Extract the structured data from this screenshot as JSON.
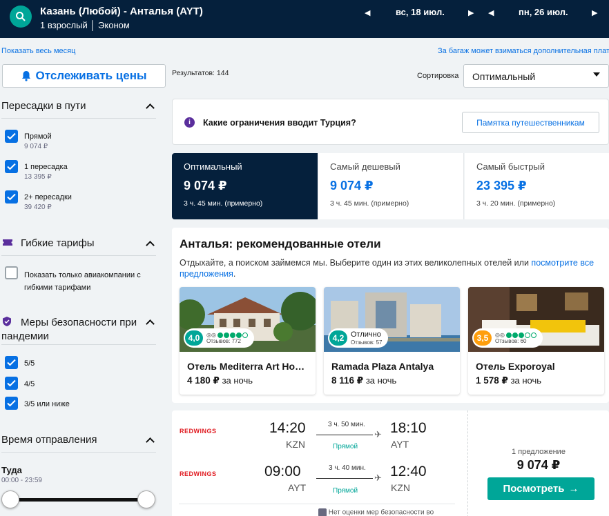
{
  "header": {
    "route": "Казань (Любой) - Анталья (AYT)",
    "passengers": "1 взрослый │ Эконом",
    "depart_date": "вс, 18 июл.",
    "return_date": "пн, 26 июл."
  },
  "links": {
    "whole_month": "Показать весь месяц",
    "baggage_note": "За багаж может взиматься дополнительная плата"
  },
  "track_button": "Отслеживать цены",
  "results_count": "Результатов: 144",
  "sort": {
    "label": "Сортировка",
    "value": "Оптимальный"
  },
  "filters": {
    "stops": {
      "title": "Пересадки в пути",
      "options": [
        {
          "label": "Прямой",
          "price": "9 074 ₽",
          "checked": true
        },
        {
          "label": "1 пересадка",
          "price": "13 395 ₽",
          "checked": true
        },
        {
          "label": "2+ пересадки",
          "price": "39 420 ₽",
          "checked": true
        }
      ]
    },
    "flexible": {
      "title": "Гибкие тарифы",
      "option": "Показать только авиакомпании с гибкими тарифами"
    },
    "safety": {
      "title": "Меры безопасности при пандемии",
      "options": [
        "5/5",
        "4/5",
        "3/5 или ниже"
      ]
    },
    "departure_time": {
      "title": "Время отправления",
      "leg": "Туда",
      "range": "00:00 - 23:59"
    }
  },
  "turkey_banner": {
    "text": "Какие ограничения вводит Турция?",
    "button": "Памятка путешественникам"
  },
  "sort_tabs": [
    {
      "title": "Оптимальный",
      "price": "9 074 ₽",
      "duration": "3 ч. 45 мин. (примерно)"
    },
    {
      "title": "Самый дешевый",
      "price": "9 074 ₽",
      "duration": "3 ч. 45 мин. (примерно)"
    },
    {
      "title": "Самый быстрый",
      "price": "23 395 ₽",
      "duration": "3 ч. 20 мин. (примерно)"
    }
  ],
  "hotels": {
    "title": "Анталья: рекомендованные отели",
    "subtitle": "Отдыхайте, а поиском займемся мы. Выберите один из этих великолепных отелей или",
    "link": "посмотрите все предложения",
    "period": ".",
    "per_night": "за ночь",
    "items": [
      {
        "score": "4,0",
        "word": "",
        "reviews": "Отзывов: 772",
        "name": "Отель Mediterra Art Ho…",
        "price": "4 180 ₽",
        "color": "#00a698",
        "owls": 4
      },
      {
        "score": "4,2",
        "word": "Отлично",
        "reviews": "Отзывов: 57",
        "name": "Ramada Plaza Antalya",
        "price": "8 116 ₽",
        "color": "#00a698",
        "owls": 0
      },
      {
        "score": "3,5",
        "word": "",
        "reviews": "Отзывов: 60",
        "name": "Отель Exporoyal",
        "price": "1 578 ₽",
        "color": "#ff9e0c",
        "owls": 3
      }
    ]
  },
  "flight": {
    "airline": {
      "red": "RED",
      "rest": "WINGS"
    },
    "legs": [
      {
        "dep_time": "14:20",
        "dep_ap": "KZN",
        "duration": "3 ч. 50 мин.",
        "stops": "Прямой",
        "arr_time": "18:10",
        "arr_ap": "AYT"
      },
      {
        "dep_time": "09:00",
        "dep_ap": "AYT",
        "duration": "3 ч. 40 мин.",
        "stops": "Прямой",
        "arr_time": "12:40",
        "arr_ap": "KZN"
      }
    ],
    "offers": "1 предложение",
    "price": "9 074 ₽",
    "button": "Посмотреть",
    "safety_note": "Нет оценки мер безопасности во"
  },
  "colors": {
    "navy": "#05203c",
    "accent": "#0770e3",
    "teal": "#00a698",
    "orange": "#ff9e0c"
  }
}
